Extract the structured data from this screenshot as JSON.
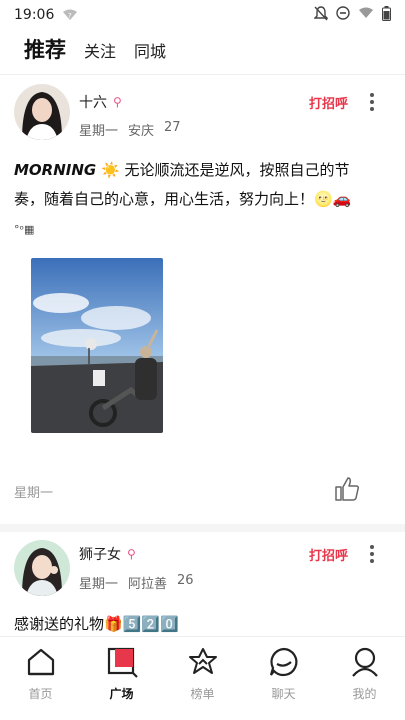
{
  "status_bar": {
    "time": "19:06"
  },
  "tabs": [
    {
      "label": "推荐",
      "active": true
    },
    {
      "label": "关注",
      "active": false
    },
    {
      "label": "同城",
      "active": false
    }
  ],
  "posts": [
    {
      "username": "十六",
      "gender_icon": "female-icon",
      "day": "星期一",
      "city": "安庆",
      "age": "27",
      "greet": "打招呼",
      "text_bold": "MORNING",
      "text_line1": " ☀️ 无论顺流还是逆风，按照自己的节",
      "text_line2": "奏，随着自己的心意，用心生活，努力向上！🌝🚗",
      "text_line3": "°ᵒ▦",
      "footer_day": "星期一"
    },
    {
      "username": "狮子女",
      "gender_icon": "female-icon",
      "day": "星期一",
      "city": "阿拉善",
      "age": "26",
      "greet": "打招呼",
      "text": "感谢送的礼物🎁5️⃣2️⃣0️⃣"
    }
  ],
  "bottom_nav": [
    {
      "label": "首页",
      "icon": "home-icon",
      "active": false
    },
    {
      "label": "广场",
      "icon": "plaza-icon",
      "active": true
    },
    {
      "label": "榜单",
      "icon": "ranking-icon",
      "active": false
    },
    {
      "label": "聊天",
      "icon": "chat-icon",
      "active": false
    },
    {
      "label": "我的",
      "icon": "profile-icon",
      "active": false
    }
  ],
  "colors": {
    "accent": "#e8374a",
    "female": "#e8568a"
  }
}
